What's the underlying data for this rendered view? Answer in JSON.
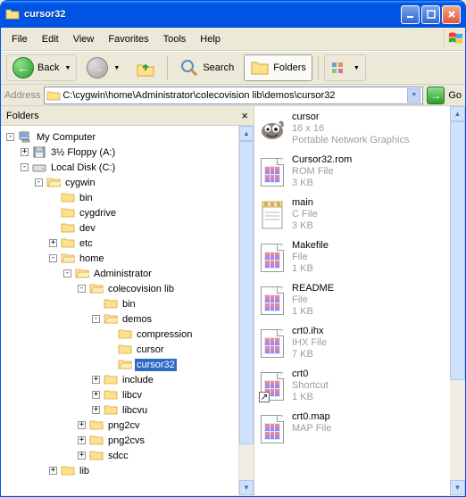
{
  "window": {
    "title": "cursor32"
  },
  "menu": {
    "file": "File",
    "edit": "Edit",
    "view": "View",
    "favorites": "Favorites",
    "tools": "Tools",
    "help": "Help"
  },
  "toolbar": {
    "back": "Back",
    "search": "Search",
    "folders": "Folders"
  },
  "address": {
    "label": "Address",
    "path": "C:\\cygwin\\home\\Administrator\\colecovision lib\\demos\\cursor32",
    "go": "Go"
  },
  "tree": {
    "header": "Folders",
    "root": "My Computer",
    "floppy": "3½ Floppy (A:)",
    "localdisk": "Local Disk (C:)",
    "items": {
      "cygwin": "cygwin",
      "bin": "bin",
      "cygdrive": "cygdrive",
      "dev": "dev",
      "etc": "etc",
      "home": "home",
      "administrator": "Administrator",
      "colecovision": "colecovision lib",
      "bin2": "bin",
      "demos": "demos",
      "compression": "compression",
      "cursor": "cursor",
      "cursor32": "cursor32",
      "include": "include",
      "libcv": "libcv",
      "libcvu": "libcvu",
      "png2cv": "png2cv",
      "png2cvs": "png2cvs",
      "sdcc": "sdcc",
      "lib": "lib"
    }
  },
  "files": [
    {
      "name": "cursor",
      "line2": "16 x 16",
      "line3": "Portable Network Graphics",
      "icon": "gimp"
    },
    {
      "name": "Cursor32.rom",
      "line2": "ROM File",
      "line3": "3 KB",
      "icon": "rom"
    },
    {
      "name": "main",
      "line2": "C File",
      "line3": "3 KB",
      "icon": "notepad"
    },
    {
      "name": "Makefile",
      "line2": "File",
      "line3": "1 KB",
      "icon": "file"
    },
    {
      "name": "README",
      "line2": "File",
      "line3": "1 KB",
      "icon": "file"
    },
    {
      "name": "crt0.ihx",
      "line2": "IHX File",
      "line3": "7 KB",
      "icon": "file"
    },
    {
      "name": "crt0",
      "line2": "Shortcut",
      "line3": "1 KB",
      "icon": "shortcut"
    },
    {
      "name": "crt0.map",
      "line2": "MAP File",
      "line3": "",
      "icon": "file"
    }
  ]
}
